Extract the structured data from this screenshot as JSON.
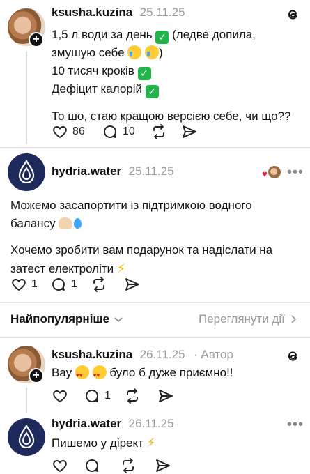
{
  "post": {
    "username": "ksusha.kuzina",
    "date": "25.11.25",
    "line1_text": "1,5 л води за день",
    "line1_tail": "(ледве допила,",
    "line2_text": "змушую себе",
    "line2_tail": ")",
    "line3_text": "10 тисяч кроків",
    "line4_text": "Дефіцит калорій",
    "line5_text": "То шо, стаю кращою версією себе, чи що??",
    "likes": "86",
    "replies": "10"
  },
  "reply1": {
    "username": "hydria.water",
    "date": "25.11.25",
    "more_label": "•••",
    "para1": "Можемо засапортити із підтримкою водного",
    "para1_line2": "балансу",
    "para2_line1": "Хочемо зробити вам подарунок та надіслати на",
    "para2_line2": "затест електроліти",
    "likes": "1",
    "replies": "1"
  },
  "sort": {
    "label": "Найпопулярніше",
    "view_activity": "Переглянути дії"
  },
  "comment1": {
    "username": "ksusha.kuzina",
    "date": "26.11.25",
    "author_label": "· Автор",
    "text_before": "Вау",
    "text_after": "було б дуже приємно!!",
    "replies": "1"
  },
  "comment2": {
    "username": "hydria.water",
    "date": "26.11.25",
    "more_label": "•••",
    "text": "Пишемо у дірект"
  },
  "icons": {
    "threads": "threads-icon",
    "heart": "heart-icon",
    "comment": "comment-icon",
    "repost": "repost-icon",
    "share": "share-icon"
  }
}
